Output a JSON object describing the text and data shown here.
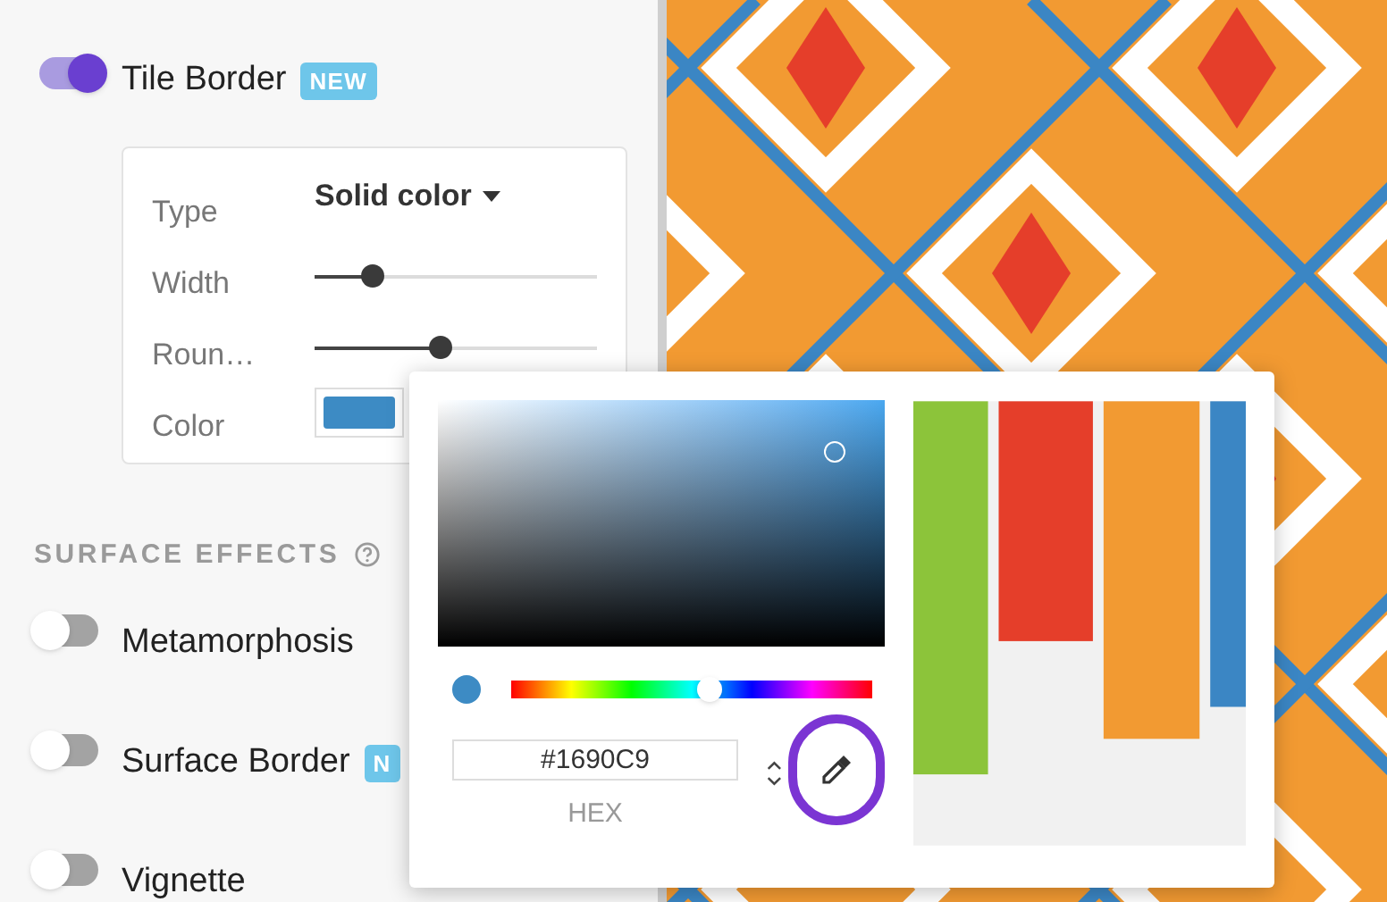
{
  "tile_border": {
    "label": "Tile Border",
    "badge": "NEW",
    "on": true
  },
  "border_settings": [
    {
      "kind": "dropdown",
      "label": "Type",
      "value": "Solid color"
    },
    {
      "kind": "slider",
      "label": "Width",
      "level": 0.2
    },
    {
      "kind": "slider",
      "label": "Roun…",
      "level": 0.44
    },
    {
      "kind": "color",
      "label": "Color"
    }
  ],
  "surface_effects": {
    "title": "SURFACE EFFECTS",
    "items": [
      {
        "label": "Metamorphosis",
        "on": false
      },
      {
        "label": "Surface Border",
        "badge": "N",
        "on": false
      },
      {
        "label": "Vignette",
        "on": false
      }
    ]
  },
  "color_picker": {
    "hue": {
      "level": 0.55
    },
    "hex": "#1690C9",
    "hex_label": "HEX"
  }
}
